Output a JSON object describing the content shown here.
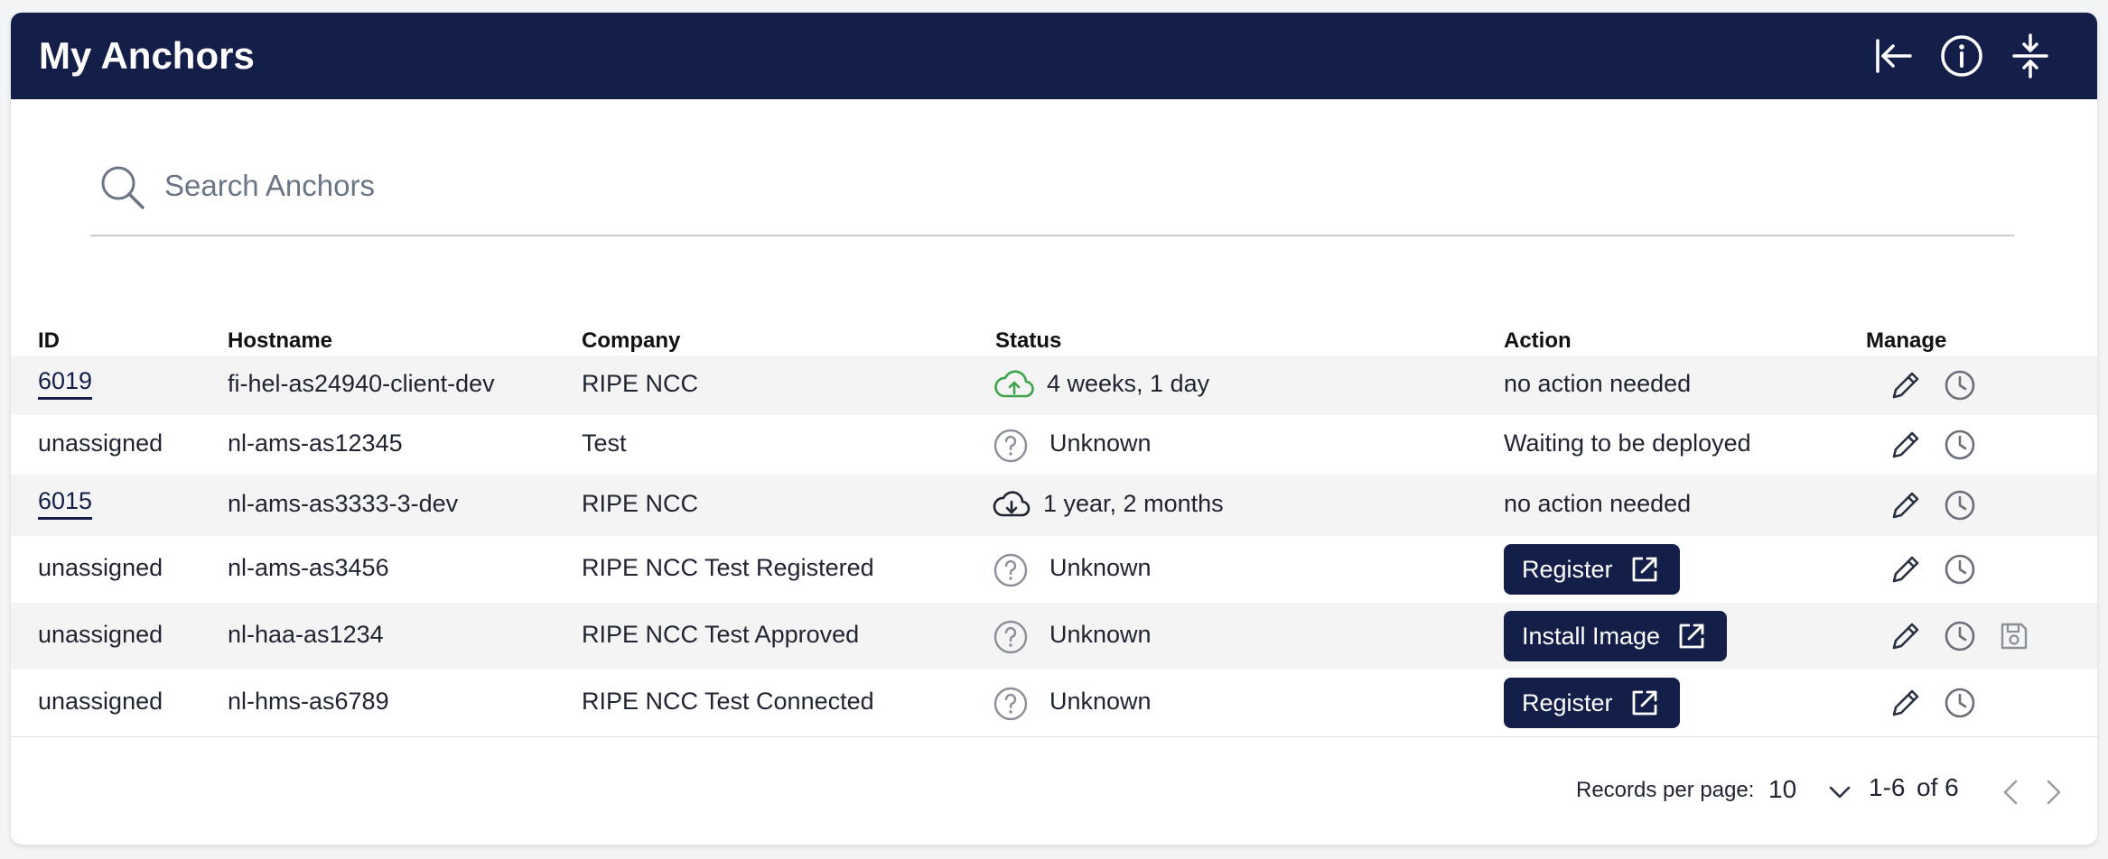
{
  "header": {
    "title": "My Anchors",
    "icons": [
      "collapse-left-icon",
      "info-icon",
      "compress-icon"
    ]
  },
  "search": {
    "placeholder": "Search Anchors",
    "value": ""
  },
  "table": {
    "columns": [
      "ID",
      "Hostname",
      "Company",
      "Status",
      "Action",
      "Manage"
    ],
    "rows": [
      {
        "id": "6019",
        "id_link": true,
        "hostname": "fi-hel-as24940-client-dev",
        "company": "RIPE NCC",
        "status_icon": "cloud-up-icon",
        "status": "4 weeks, 1 day",
        "action": "no action needed",
        "action_type": "text",
        "manage": [
          "edit-icon",
          "history-icon"
        ]
      },
      {
        "id": "unassigned",
        "id_link": false,
        "hostname": "nl-ams-as12345",
        "company": "Test",
        "status_icon": "question-icon",
        "status": "Unknown",
        "action": "Waiting to be deployed",
        "action_type": "text",
        "manage": [
          "edit-icon",
          "history-icon"
        ]
      },
      {
        "id": "6015",
        "id_link": true,
        "hostname": "nl-ams-as3333-3-dev",
        "company": "RIPE NCC",
        "status_icon": "cloud-down-icon",
        "status": "1 year, 2 months",
        "action": "no action needed",
        "action_type": "text",
        "manage": [
          "edit-icon",
          "history-icon"
        ]
      },
      {
        "id": "unassigned",
        "id_link": false,
        "hostname": "nl-ams-as3456",
        "company": "RIPE NCC Test Registered",
        "status_icon": "question-icon",
        "status": "Unknown",
        "action": "Register",
        "action_type": "button",
        "manage": [
          "edit-icon",
          "history-icon"
        ]
      },
      {
        "id": "unassigned",
        "id_link": false,
        "hostname": "nl-haa-as1234",
        "company": "RIPE NCC Test Approved",
        "status_icon": "question-icon",
        "status": "Unknown",
        "action": "Install Image",
        "action_type": "button",
        "manage": [
          "edit-icon",
          "history-icon",
          "save-icon"
        ]
      },
      {
        "id": "unassigned",
        "id_link": false,
        "hostname": "nl-hms-as6789",
        "company": "RIPE NCC Test Connected",
        "status_icon": "question-icon",
        "status": "Unknown",
        "action": "Register",
        "action_type": "button",
        "manage": [
          "edit-icon",
          "history-icon"
        ]
      }
    ]
  },
  "pagination": {
    "records_label": "Records per page:",
    "per_page": "10",
    "range": "1-6",
    "of": "of 6"
  },
  "colors": {
    "header_bg": "#141f49",
    "button_bg": "#141f49",
    "row_alt_bg": "#f4f4f5",
    "cloud_up": "#3fa34d"
  }
}
